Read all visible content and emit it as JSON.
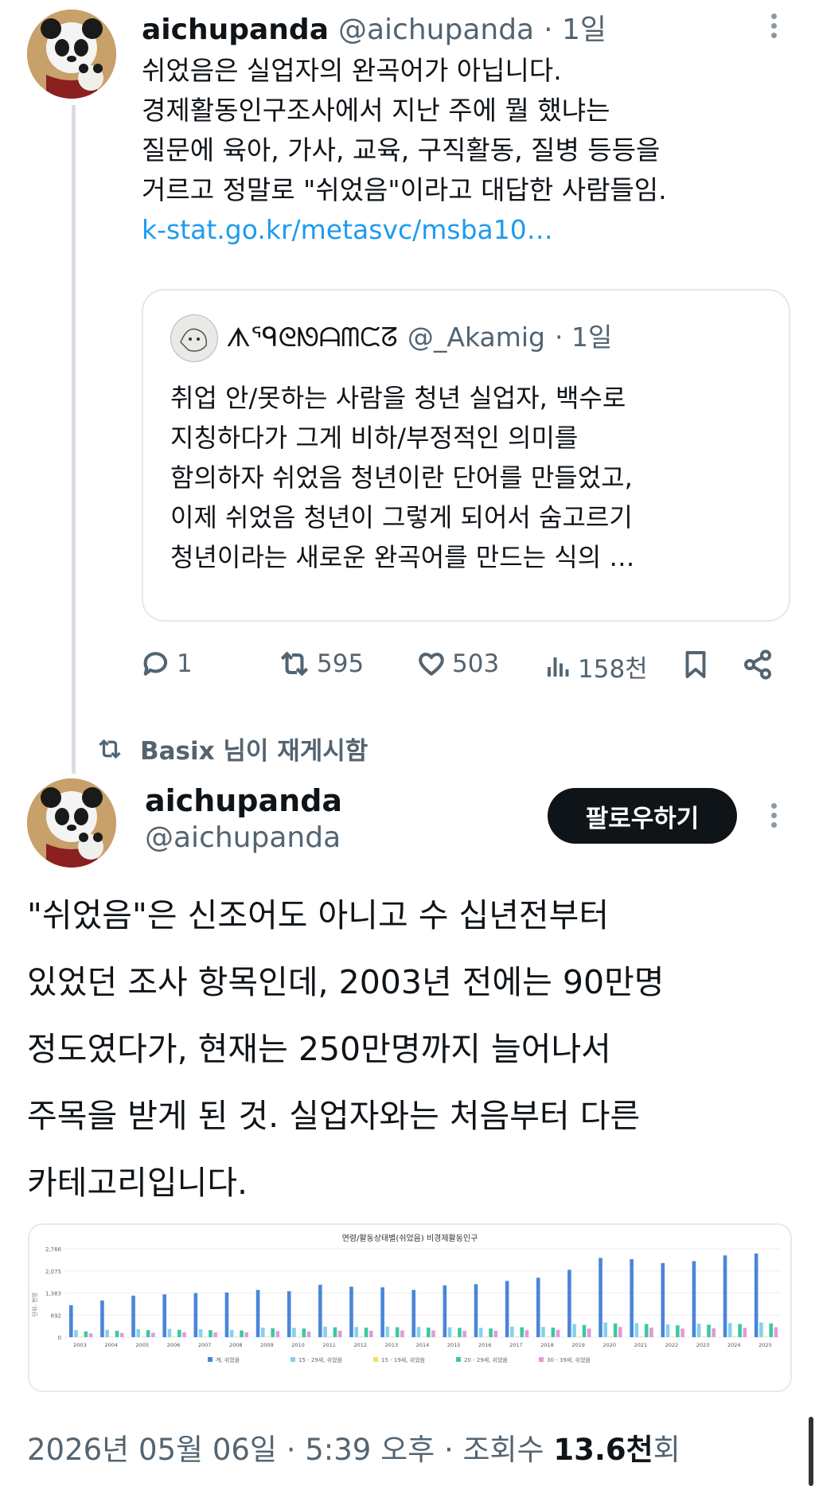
{
  "first_tweet": {
    "author_name": "aichupanda",
    "author_handle": "@aichupanda",
    "time": "· 1일",
    "lines": [
      "쉬었음은 실업자의 완곡어가 아닙니다.",
      "경제활동인구조사에서 지난 주에 뭘 했냐는",
      "질문에 육아, 가사, 교육, 구직활동, 질병 등등을",
      "거르고 정말로 \"쉬었음\"이라고 대답한 사람들임."
    ],
    "link": "k-stat.go.kr/metasvc/msba10…",
    "quote": {
      "author_name": "ᗑᙯᘓᘚᗩᗰᙅᘔ",
      "author_handle": "@_Akamig",
      "time": "· 1일",
      "lines": [
        "취업 안/못하는 사람을 청년 실업자, 백수로",
        "지칭하다가 그게 비하/부정적인 의미를",
        "함의하자 쉬었음 청년이란 단어를 만들었고,",
        "이제 쉬었음 청년이 그렇게 되어서 숨고르기",
        "청년이라는 새로운 완곡어를 만드는 식의 …"
      ]
    },
    "actions": {
      "replies": "1",
      "reposts": "595",
      "likes": "503",
      "views": "158천"
    }
  },
  "repost_notice": "Basix 님이 재게시함",
  "main_tweet": {
    "author_name": "aichupanda",
    "author_handle": "@aichupanda",
    "follow_label": "팔로우하기",
    "lines": [
      "\"쉬었음\"은 신조어도 아니고 수 십년전부터",
      "있었던 조사 항목인데, 2003년 전에는 90만명",
      "정도였다가, 현재는 250만명까지 늘어나서",
      "주목을 받게 된 것. 실업자와는 처음부터 다른",
      "카테고리입니다."
    ],
    "footer": {
      "date_time": "2026년 05월 06일 · 5:39 오후 · 조회수",
      "views": "13.6천",
      "suffix": "회"
    }
  },
  "colors": {
    "link": "#1d9bf0",
    "muted": "#536471",
    "text": "#0f1419"
  },
  "chart_data": {
    "type": "bar",
    "title": "연령/활동상태별(쉬었음) 비경제활동인구",
    "ylabel": "단위: 천명",
    "ylim": [
      0,
      2766
    ],
    "yticks": [
      "2,766",
      "2,075",
      "1,383",
      "692",
      "0"
    ],
    "categories": [
      "2003",
      "2004",
      "2005",
      "2006",
      "2007",
      "2008",
      "2009",
      "2010",
      "2011",
      "2012",
      "2013",
      "2014",
      "2015",
      "2016",
      "2017",
      "2018",
      "2019",
      "2020",
      "2021",
      "2022",
      "2023",
      "2024",
      "2025"
    ],
    "series": [
      {
        "name": "계, 쉬었음",
        "color": "#4a86d8",
        "values": [
          1000,
          1150,
          1300,
          1340,
          1380,
          1400,
          1480,
          1440,
          1640,
          1580,
          1560,
          1480,
          1620,
          1660,
          1760,
          1860,
          2110,
          2480,
          2440,
          2320,
          2380,
          2560,
          2620
        ]
      },
      {
        "name": "15 - 29세, 쉬었음",
        "color": "#86d0ef",
        "values": [
          220,
          230,
          250,
          260,
          250,
          230,
          300,
          290,
          330,
          320,
          330,
          320,
          310,
          290,
          330,
          320,
          410,
          460,
          440,
          400,
          420,
          440,
          460
        ]
      },
      {
        "name": "15 - 19세, 쉬었음",
        "color": "#f3df62",
        "values": [
          20,
          20,
          20,
          20,
          20,
          20,
          20,
          20,
          20,
          20,
          20,
          20,
          20,
          20,
          20,
          20,
          20,
          20,
          20,
          20,
          20,
          20,
          20
        ]
      },
      {
        "name": "20 - 29세, 쉬었음",
        "color": "#3dc7a4",
        "values": [
          180,
          200,
          220,
          230,
          220,
          210,
          280,
          270,
          310,
          300,
          310,
          300,
          290,
          270,
          310,
          300,
          380,
          430,
          410,
          370,
          390,
          410,
          430
        ]
      },
      {
        "name": "30 - 39세, 쉬었음",
        "color": "#e29ad8",
        "values": [
          120,
          130,
          140,
          150,
          150,
          150,
          190,
          180,
          200,
          200,
          210,
          210,
          200,
          200,
          220,
          230,
          270,
          320,
          300,
          270,
          280,
          290,
          310
        ]
      }
    ]
  }
}
